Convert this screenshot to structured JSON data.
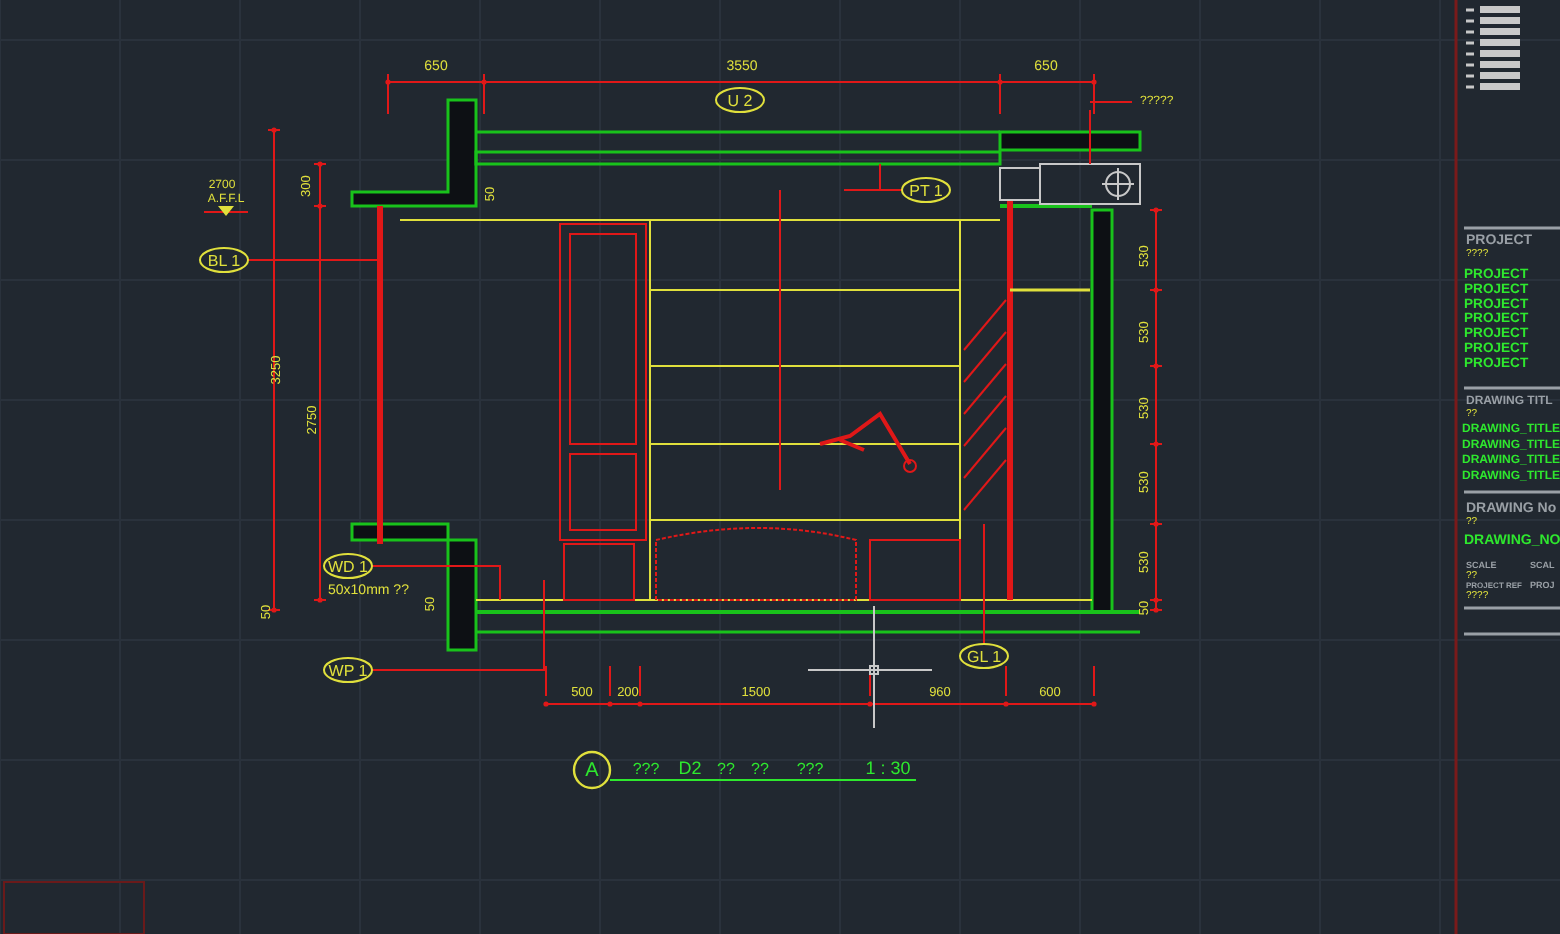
{
  "drawing": {
    "top_dimensions": [
      "650",
      "3550",
      "650"
    ],
    "left_dimensions": [
      "300",
      "50",
      "3250",
      "2750",
      "50",
      "50"
    ],
    "right_dimensions": [
      "530",
      "530",
      "530",
      "530",
      "530",
      "50"
    ],
    "bottom_dimensions": [
      "500",
      "200",
      "1500",
      "960",
      "600"
    ],
    "tags": [
      {
        "text": "U 2"
      },
      {
        "text": "PT 1"
      },
      {
        "text": "BL 1"
      },
      {
        "text": "WD 1"
      },
      {
        "text": "WP 1"
      },
      {
        "text": "GL 1"
      }
    ],
    "notes": [
      "?????",
      "2700",
      "A.F.F.L",
      "50x10mm ??"
    ],
    "title": {
      "mark": "A",
      "words": [
        "???",
        "D2",
        "??",
        "??",
        "???"
      ],
      "scale": "1 : 30"
    }
  },
  "title_block": {
    "project": {
      "heading": "PROJECT",
      "code": "????",
      "lines": [
        "PROJECT",
        "PROJECT",
        "PROJECT",
        "PROJECT",
        "PROJECT",
        "PROJECT",
        "PROJECT"
      ]
    },
    "drawing_title": {
      "heading": "DRAWING TITL",
      "code": "??",
      "lines": [
        "DRAWING_TITLE",
        "DRAWING_TITLE",
        "DRAWING_TITLE",
        "DRAWING_TITLE"
      ]
    },
    "drawing_no": {
      "heading": "DRAWING No",
      "code": "??",
      "value": "DRAWING_NO"
    },
    "scale": {
      "label": "SCALE",
      "value": "??",
      "cut_label": "SCAL"
    },
    "project_ref": {
      "label": "PROJECT REF",
      "value": "????",
      "cut_label": "PROJ"
    }
  }
}
